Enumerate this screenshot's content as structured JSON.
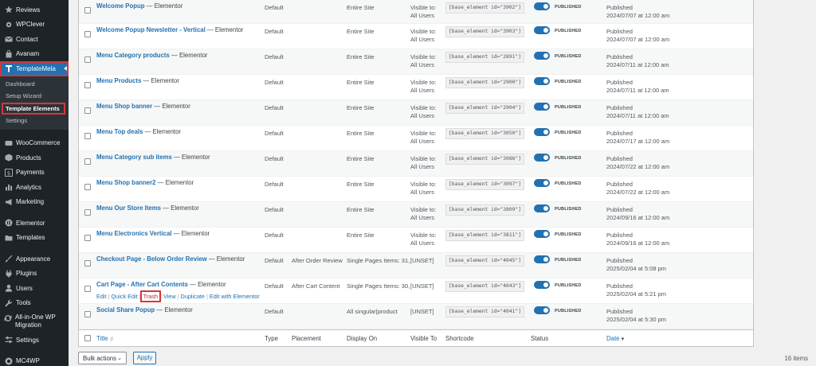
{
  "sidebar": {
    "top_items": [
      {
        "label": "Reviews",
        "icon": "star-icon"
      },
      {
        "label": "WPClever",
        "icon": "gear-icon"
      },
      {
        "label": "Contact",
        "icon": "envelope-icon"
      },
      {
        "label": "Avanam",
        "icon": "shopping-bag-icon"
      }
    ],
    "active_item": {
      "label": "TemplateMela",
      "icon": "template-icon"
    },
    "submenu": [
      "Dashboard",
      "Setup Wizard",
      "Template Elements",
      "Settings"
    ],
    "lower_items": [
      {
        "label": "WooCommerce",
        "icon": "woo-icon"
      },
      {
        "label": "Products",
        "icon": "box-icon"
      },
      {
        "label": "Payments",
        "icon": "dollar-icon"
      },
      {
        "label": "Analytics",
        "icon": "bar-chart-icon"
      },
      {
        "label": "Marketing",
        "icon": "megaphone-icon"
      }
    ],
    "group3": [
      {
        "label": "Elementor",
        "icon": "elementor-icon"
      },
      {
        "label": "Templates",
        "icon": "folder-icon"
      }
    ],
    "group4": [
      {
        "label": "Appearance",
        "icon": "brush-icon"
      },
      {
        "label": "Plugins",
        "icon": "plug-icon"
      },
      {
        "label": "Users",
        "icon": "user-icon"
      },
      {
        "label": "Tools",
        "icon": "wrench-icon"
      },
      {
        "label": "All-in-One WP Migration",
        "icon": "migration-icon"
      },
      {
        "label": "Settings",
        "icon": "settings-icon"
      }
    ],
    "group5": [
      {
        "label": "MC4WP",
        "icon": "mc4wp-icon"
      }
    ]
  },
  "table": {
    "rows": [
      {
        "title": "Welcome Popup",
        "suffix": " — Elementor",
        "type": "Default",
        "placement": "",
        "display": "Entire Site",
        "visible_1": "Visible to:",
        "visible_2": "All Users",
        "shortcode": "[base_element id=\"3902\"]",
        "status": "PUBLISHED",
        "date_1": "Published",
        "date_2": "2024/07/07 at 12:00 am"
      },
      {
        "title": "Welcome Popup Newsletter - Vertical",
        "suffix": " — Elementor",
        "type": "Default",
        "placement": "",
        "display": "Entire Site",
        "visible_1": "Visible to:",
        "visible_2": "All Users",
        "shortcode": "[base_element id=\"3903\"]",
        "status": "PUBLISHED",
        "date_1": "Published",
        "date_2": "2024/07/07 at 12:00 am"
      },
      {
        "title": "Menu Category products",
        "suffix": " — Elementor",
        "type": "Default",
        "placement": "",
        "display": "Entire Site",
        "visible_1": "Visible to:",
        "visible_2": "All Users",
        "shortcode": "[base_element id=\"2891\"]",
        "status": "PUBLISHED",
        "date_1": "Published",
        "date_2": "2024/07/11 at 12:00 am"
      },
      {
        "title": "Menu Products",
        "suffix": " — Elementor",
        "type": "Default",
        "placement": "",
        "display": "Entire Site",
        "visible_1": "Visible to:",
        "visible_2": "All Users",
        "shortcode": "[base_element id=\"2900\"]",
        "status": "PUBLISHED",
        "date_1": "Published",
        "date_2": "2024/07/11 at 12:00 am"
      },
      {
        "title": "Menu Shop banner",
        "suffix": " — Elementor",
        "type": "Default",
        "placement": "",
        "display": "Entire Site",
        "visible_1": "Visible to:",
        "visible_2": "All Users",
        "shortcode": "[base_element id=\"2904\"]",
        "status": "PUBLISHED",
        "date_1": "Published",
        "date_2": "2024/07/11 at 12:00 am"
      },
      {
        "title": "Menu Top deals",
        "suffix": " — Elementor",
        "type": "Default",
        "placement": "",
        "display": "Entire Site",
        "visible_1": "Visible to:",
        "visible_2": "All Users",
        "shortcode": "[base_element id=\"3050\"]",
        "status": "PUBLISHED",
        "date_1": "Published",
        "date_2": "2024/07/17 at 12:00 am"
      },
      {
        "title": "Menu Category sub items",
        "suffix": " — Elementor",
        "type": "Default",
        "placement": "",
        "display": "Entire Site",
        "visible_1": "Visible to:",
        "visible_2": "All Users",
        "shortcode": "[base_element id=\"3086\"]",
        "status": "PUBLISHED",
        "date_1": "Published",
        "date_2": "2024/07/22 at 12:00 am"
      },
      {
        "title": "Menu Shop banner2",
        "suffix": " — Elementor",
        "type": "Default",
        "placement": "",
        "display": "Entire Site",
        "visible_1": "Visible to:",
        "visible_2": "All Users",
        "shortcode": "[base_element id=\"3097\"]",
        "status": "PUBLISHED",
        "date_1": "Published",
        "date_2": "2024/07/22 at 12:00 am"
      },
      {
        "title": "Menu Our Store Items",
        "suffix": " — Elementor",
        "type": "Default",
        "placement": "",
        "display": "Entire Site",
        "visible_1": "Visible to:",
        "visible_2": "All Users",
        "shortcode": "[base_element id=\"3809\"]",
        "status": "PUBLISHED",
        "date_1": "Published",
        "date_2": "2024/09/16 at 12:00 am"
      },
      {
        "title": "Menu Electronics Vertical",
        "suffix": " — Elementor",
        "type": "Default",
        "placement": "",
        "display": "Entire Site",
        "visible_1": "Visible to:",
        "visible_2": "All Users",
        "shortcode": "[base_element id=\"3811\"]",
        "status": "PUBLISHED",
        "date_1": "Published",
        "date_2": "2024/09/16 at 12:00 am"
      },
      {
        "title": "Checkout Page - Below Order Review",
        "suffix": " — Elementor",
        "type": "Default",
        "placement": "After Order Review",
        "display": "Single Pages Items: 31,",
        "visible_1": "[UNSET]",
        "visible_2": "",
        "shortcode": "[base_element id=\"4045\"]",
        "status": "PUBLISHED",
        "date_1": "Published",
        "date_2": "2025/02/04 at 5:08 pm"
      },
      {
        "title": "Cart Page - After Cart Contents",
        "suffix": " — Elementor",
        "type": "Default",
        "placement": "After Cart Content",
        "display": "Single Pages Items: 30,",
        "visible_1": "[UNSET]",
        "visible_2": "",
        "shortcode": "[base_element id=\"4043\"]",
        "status": "PUBLISHED",
        "date_1": "Published",
        "date_2": "2025/02/04 at 5:21 pm"
      },
      {
        "title": "Social Share Popup",
        "suffix": " — Elementor",
        "type": "Default",
        "placement": "",
        "display": "All singular|product",
        "visible_1": "[UNSET]",
        "visible_2": "",
        "shortcode": "[base_element id=\"4041\"]",
        "status": "PUBLISHED",
        "date_1": "Published",
        "date_2": "2025/02/04 at 5:30 pm"
      }
    ],
    "row_actions": {
      "edit": "Edit",
      "quick_edit": "Quick Edit",
      "trash": "Trash",
      "view": "View",
      "duplicate": "Duplicate",
      "edit_elementor": "Edit with Elementor",
      "sep": "|"
    },
    "footer_headers": {
      "title": "Title",
      "type": "Type",
      "placement": "Placement",
      "display": "Display On",
      "visible": "Visible To",
      "shortcode": "Shortcode",
      "status": "Status",
      "date": "Date"
    }
  },
  "tablenav": {
    "bulk_label": "Bulk actions",
    "apply_label": "Apply",
    "count": "16 items"
  }
}
